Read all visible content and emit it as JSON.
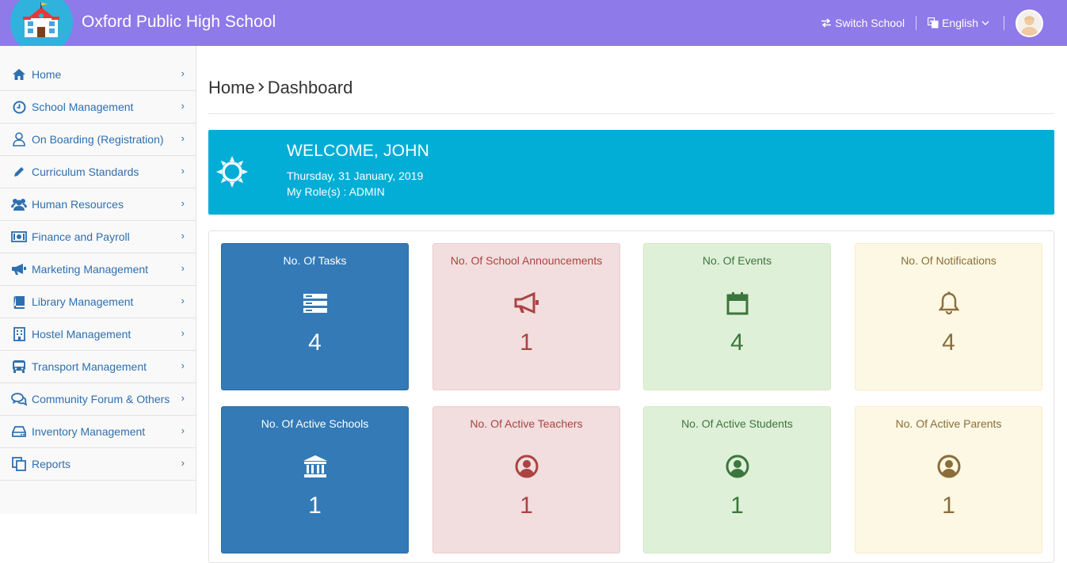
{
  "header": {
    "school_name": "Oxford Public High School",
    "switch_school": "Switch School",
    "language": "English"
  },
  "sidebar": {
    "items": [
      {
        "label": "Home"
      },
      {
        "label": "School Management"
      },
      {
        "label": "On Boarding (Registration)"
      },
      {
        "label": "Curriculum Standards"
      },
      {
        "label": "Human Resources"
      },
      {
        "label": "Finance and Payroll"
      },
      {
        "label": "Marketing Management"
      },
      {
        "label": "Library Management"
      },
      {
        "label": "Hostel Management"
      },
      {
        "label": "Transport Management"
      },
      {
        "label": "Community Forum & Others"
      },
      {
        "label": "Inventory Management"
      },
      {
        "label": "Reports"
      }
    ]
  },
  "breadcrumb": {
    "home": "Home",
    "current": "Dashboard"
  },
  "welcome": {
    "title": "WELCOME, JOHN",
    "date": "Thursday, 31 January, 2019",
    "role": "My Role(s) : ADMIN"
  },
  "stats": [
    {
      "title": "No. Of Tasks",
      "value": "4"
    },
    {
      "title": "No. Of School Announcements",
      "value": "1"
    },
    {
      "title": "No. Of Events",
      "value": "4"
    },
    {
      "title": "No. Of Notifications",
      "value": "4"
    },
    {
      "title": "No. Of Active Schools",
      "value": "1"
    },
    {
      "title": "No. Of Active Teachers",
      "value": "1"
    },
    {
      "title": "No. Of Active Students",
      "value": "1"
    },
    {
      "title": "No. Of Active Parents",
      "value": "1"
    }
  ],
  "colors": {
    "header": "#8e7ae8",
    "welcome": "#02aed6",
    "blue": "#337ab7",
    "red": "#f2dede",
    "green": "#dff0d8",
    "yellow": "#fcf8e3"
  }
}
